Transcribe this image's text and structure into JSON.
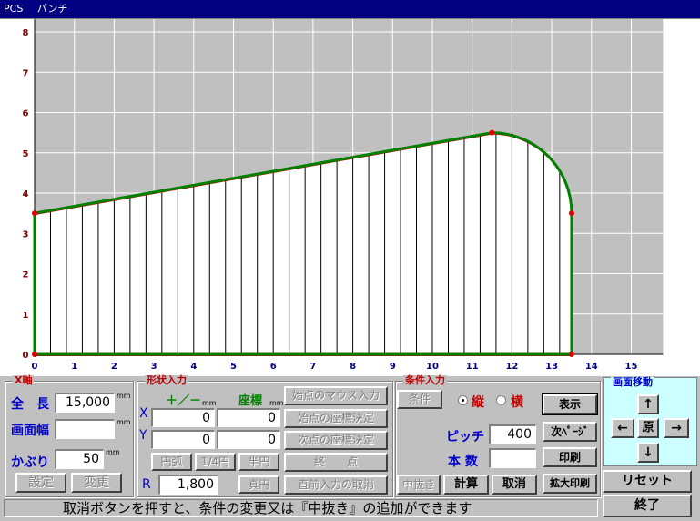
{
  "window": {
    "title_left": "PCS",
    "title_right": "パンチ"
  },
  "chart_data": {
    "type": "line",
    "x_ticks": [
      0,
      1,
      2,
      3,
      4,
      5,
      6,
      7,
      8,
      9,
      10,
      11,
      12,
      13,
      14,
      15
    ],
    "y_ticks": [
      0,
      1,
      2,
      3,
      4,
      5,
      6,
      7,
      8
    ],
    "xlim": [
      0,
      15.8
    ],
    "ylim": [
      0,
      8.5
    ],
    "grid": true,
    "outline": {
      "start_y": 3.5,
      "arc_start_x": 11.5,
      "arc_start_y": 5.5,
      "end_x": 13.5,
      "end_y": 3.5
    },
    "pitch": 0.4,
    "colors": {
      "outline": "#008000",
      "shape": "#c00000",
      "points": "#e00000",
      "grid": "#c0c0c0",
      "axis_label": "#800000"
    }
  },
  "x_axis": {
    "legend": "X軸",
    "length_label": "全　長",
    "length_value": "15,000",
    "length_unit": "mm",
    "width_label": "画面幅",
    "width_value": "",
    "width_unit": "mm",
    "kaburi_label": "かぶり",
    "kaburi_value": "50",
    "kaburi_unit": "mm",
    "set_button": "設定",
    "change_button": "変更"
  },
  "shape": {
    "legend": "形状入力",
    "plusminus": "＋／－",
    "plusminus_unit": "mm",
    "coord": "座標",
    "coord_unit": "mm",
    "x_label": "X",
    "y_label": "Y",
    "x_delta": "0",
    "x_coord": "0",
    "y_delta": "0",
    "y_coord": "0",
    "arc_button": "円弧",
    "quarter_button": "1/4円",
    "half_button": "半円",
    "r_label": "R",
    "r_value": "1,800",
    "full_button": "真円",
    "mouse_start_button": "始点のマウス入力",
    "start_coord_button": "始点の座標決定",
    "next_coord_button": "次点の座標決定",
    "end_button": "終　　点",
    "undo_button": "直前入力の取消"
  },
  "cond": {
    "legend": "条件入力",
    "cond_button": "条件",
    "radio_tate": "縦",
    "radio_yoko": "横",
    "pitch_label": "ピッチ",
    "pitch_value": "400",
    "count_label": "本 数",
    "count_value": "",
    "nukiki_button": "中抜き",
    "calc_button": "計算",
    "cancel_button": "取消"
  },
  "display": {
    "show_button": "表示",
    "next_page_button": "次ﾍﾟｰｼﾞ",
    "print_button": "印刷",
    "zoom_print_button": "拡大印刷"
  },
  "move": {
    "legend": "画面移動",
    "up": "↑",
    "left": "←",
    "origin": "原",
    "right": "→",
    "down": "↓"
  },
  "reset_button": "リセット",
  "exit_button": "終了",
  "status": "取消ボタンを押すと、条件の変更又は『中抜き』の追加ができます"
}
